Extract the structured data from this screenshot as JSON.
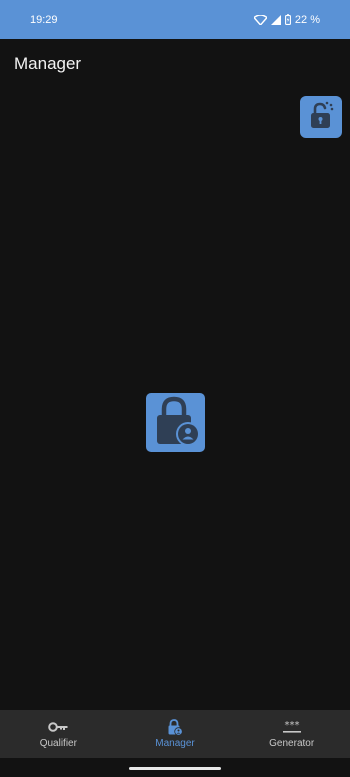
{
  "status_bar": {
    "time": "19:29",
    "battery_percent": "22 %",
    "icons": [
      "wifi-icon",
      "signal-icon",
      "battery-charging-icon"
    ]
  },
  "header": {
    "title": "Manager"
  },
  "actions": {
    "unlock_icon": "unlock-icon"
  },
  "center": {
    "icon": "lock-user-icon"
  },
  "bottom_nav": {
    "active": "Manager",
    "items": [
      {
        "label": "Qualifier",
        "icon": "key-icon"
      },
      {
        "label": "Manager",
        "icon": "lock-account-icon"
      },
      {
        "label": "Generator",
        "icon": "password-icon"
      }
    ]
  },
  "colors": {
    "accent": "#5a92d6",
    "background": "#121212",
    "nav_background": "#2b2b2b",
    "icon_dark": "#2f3f55"
  }
}
